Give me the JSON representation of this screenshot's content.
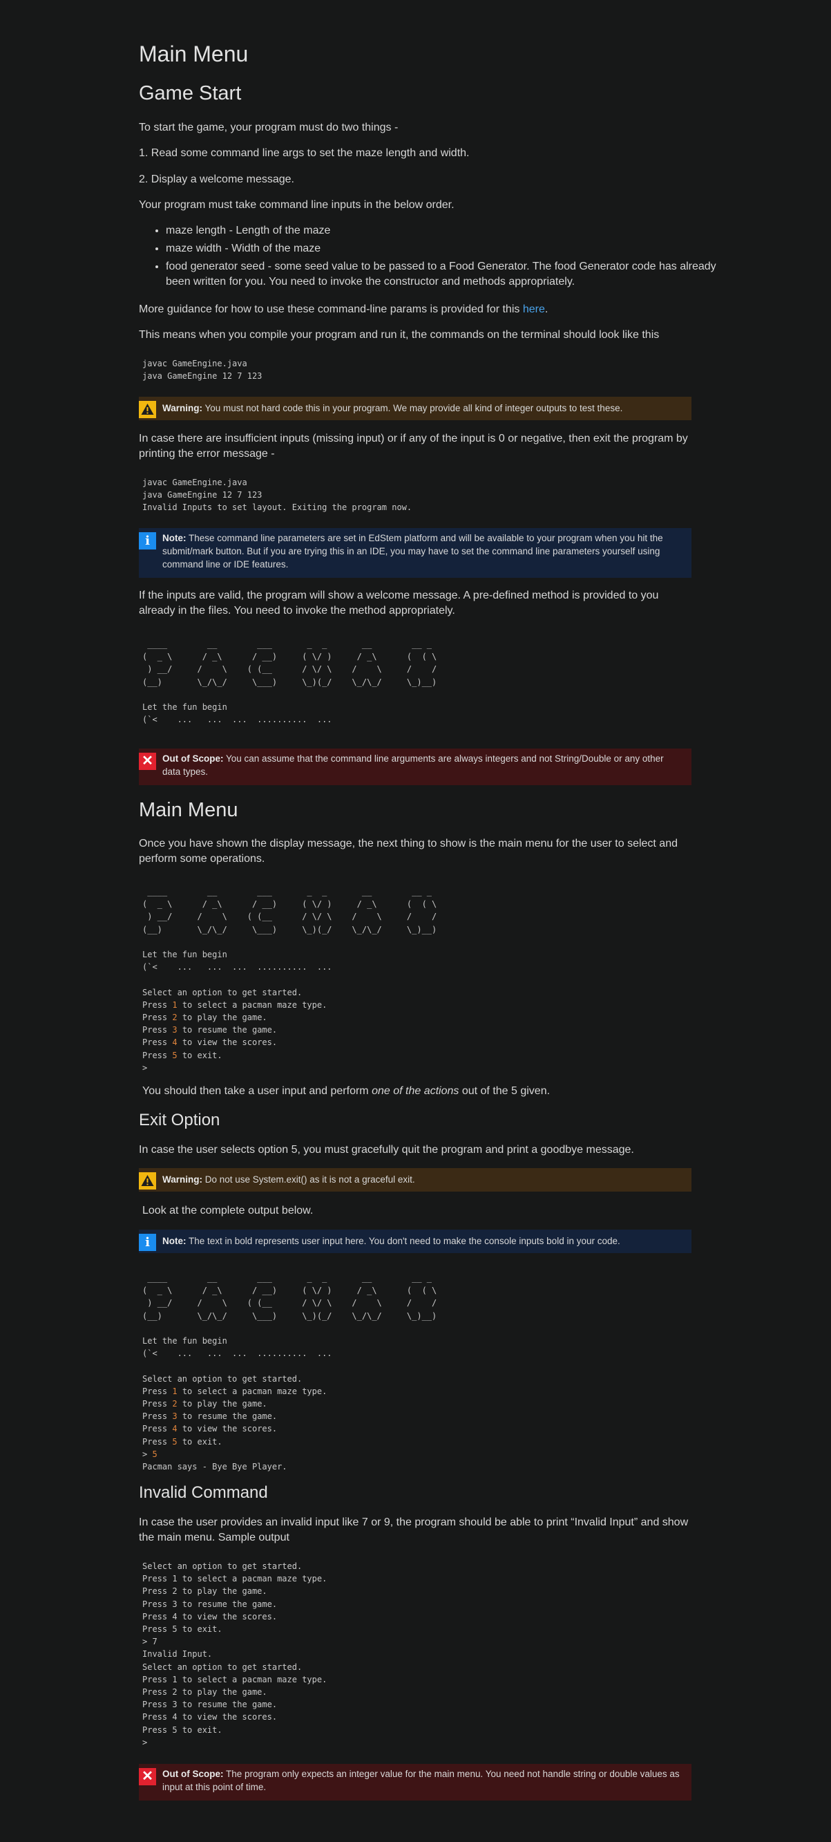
{
  "title": "Main Menu",
  "game_start": {
    "heading": "Game Start",
    "intro": "To start the game, your program must do two things -",
    "step1": "1. Read some command line args to set the maze length and width.",
    "step2": "2. Display a welcome message.",
    "order_text": "Your program must take command line inputs in the below order.",
    "bullets": [
      "maze length  - Length of the maze",
      "maze width - Width of the maze",
      "food generator seed - some seed value to be passed to a Food Generator. The food Generator code has already been written for you. You need to invoke the constructor and methods appropriately."
    ],
    "guidance_pre": "More guidance for how to use these command-line params is provided for this ",
    "guidance_link": "here",
    "guidance_post": ".",
    "compile_text": "This means when you compile your program and run it, the commands on the terminal should look like this",
    "code1": "javac GameEngine.java\njava GameEngine 12 7 123",
    "warning1_label": "Warning:",
    "warning1_text": " You must not hard code this in your program. We may provide all kind of integer outputs to test these.",
    "invalid_text": "In case there are insufficient inputs (missing input) or if any of the input is 0 or negative, then exit the program by printing the error message -",
    "code2": "javac GameEngine.java\njava GameEngine 12 7 123\nInvalid Inputs to set layout. Exiting the program now.",
    "note1_label": "Note:",
    "note1_text": " These command line parameters are set in EdStem platform and will be available to your program when you hit the submit/mark button. But if you are trying this in an IDE, you may have to set the command line parameters yourself using command line or IDE features.",
    "valid_text": "If the inputs are valid, the program will show a welcome message. A pre-defined method is provided to you already in the files. You need to invoke the method appropriately.",
    "banner_code": " ____        __        ___       _  _       __        __ _\n(  _ \\      / _\\      / __)     ( \\/ )     / _\\      (  ( \\\n ) __/     /    \\    ( (__      / \\/ \\    /    \\     /    /\n(__)       \\_/\\_/     \\___)     \\_)(_/    \\_/\\_/     \\_)__)\n\nLet the fun begin\n(`<    ...   ...  ...  ..........  ...",
    "oos1_label": "Out of Scope:",
    "oos1_text": " You can assume that the command line arguments are always integers and not String/Double or any other data types."
  },
  "main_menu": {
    "heading": "Main Menu",
    "intro": "Once you have shown the display message, the next thing to show is the main menu for the user to select and perform some operations.",
    "banner_code": " ____        __        ___       _  _       __        __ _\n(  _ \\      / _\\      / __)     ( \\/ )     / _\\      (  ( \\\n ) __/     /    \\    ( (__      / \\/ \\    /    \\     /    /\n(__)       \\_/\\_/     \\___)     \\_)(_/    \\_/\\_/     \\_)__)\n\nLet the fun begin\n(`<    ...   ...  ...  ..........  ...\n",
    "menu_lines": [
      "Select an option to get started.",
      "Press 1 to select a pacman maze type.",
      "Press 2 to play the game.",
      "Press 3 to resume the game.",
      "Press 4 to view the scores.",
      "Press 5 to exit.",
      ">"
    ],
    "take_input_pre": "You should then take a user input and perform ",
    "take_input_em": "one of the actions",
    "take_input_post": " out of the 5 given."
  },
  "exit_option": {
    "heading": "Exit Option",
    "text": "In case the user selects option 5, you must gracefully quit the program and print a goodbye message.",
    "warning_label": "Warning:",
    "warning_text": " Do not use System.exit() as it is not a graceful exit.",
    "look_text": "Look at the complete output below.",
    "note_label": "Note:",
    "note_text": " The text in bold represents user input here.  You don't need to make the console inputs bold in your code.",
    "input_line": "> 5",
    "bye_line": "Pacman says - Bye Bye Player."
  },
  "invalid_command": {
    "heading": "Invalid Command",
    "text": "In case the user provides an invalid input like 7 or 9, the program should be able to print “Invalid Input” and show the main menu. Sample output",
    "code": "Select an option to get started.\nPress 1 to select a pacman maze type.\nPress 2 to play the game.\nPress 3 to resume the game.\nPress 4 to view the scores.\nPress 5 to exit.\n> 7\nInvalid Input.\nSelect an option to get started.\nPress 1 to select a pacman maze type.\nPress 2 to play the game.\nPress 3 to resume the game.\nPress 4 to view the scores.\nPress 5 to exit.\n>",
    "oos_label": "Out of Scope:",
    "oos_text": " The program only expects an integer value for the main menu. You need not handle string or double values as input at this point of time."
  }
}
